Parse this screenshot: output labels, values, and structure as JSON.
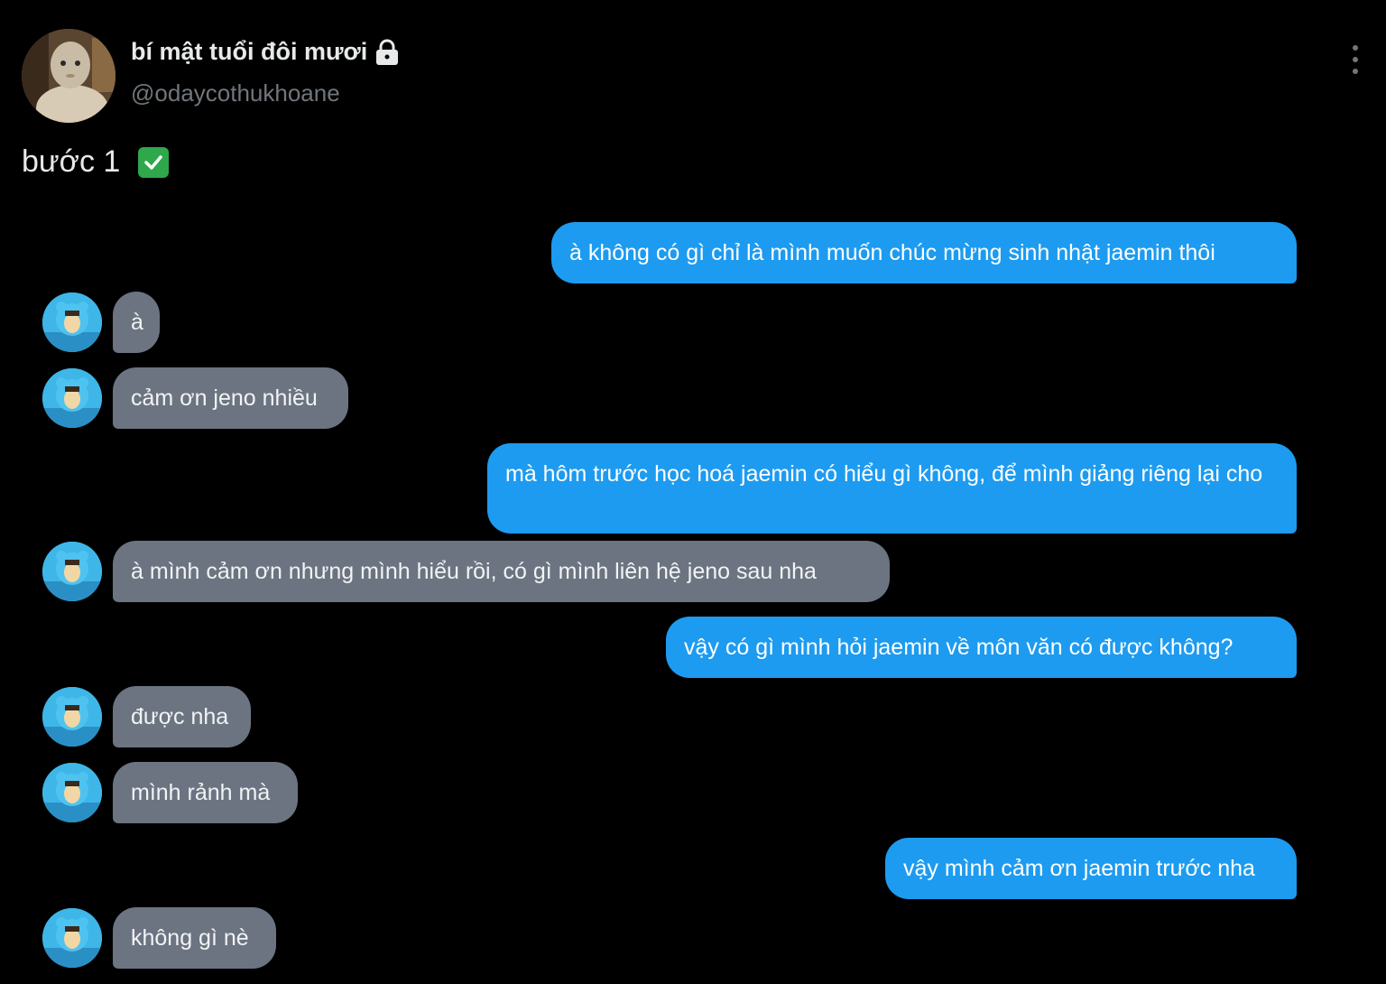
{
  "user": {
    "display_name": "bí mật tuổi đôi mươi",
    "handle": "@odaycothukhoane",
    "icons": {
      "protected": "lock-icon",
      "more": "more-dots-icon",
      "avatar": "doll-avatar"
    }
  },
  "post": {
    "text": "bước 1",
    "emoji_icon": "check-mark-icon"
  },
  "messages": [
    {
      "from": "me",
      "text": "à không có gì chỉ là mình muốn chúc mừng sinh nhật jaemin thôi"
    },
    {
      "from": "them",
      "text": "à"
    },
    {
      "from": "them",
      "text": "cảm ơn jeno nhiều"
    },
    {
      "from": "me",
      "text": "mà hôm trước học hoá jaemin có hiểu gì không, để mình giảng riêng lại cho"
    },
    {
      "from": "them",
      "text": "à mình cảm ơn nhưng mình hiểu rồi, có gì mình liên hệ jeno sau nha"
    },
    {
      "from": "me",
      "text": "vậy có gì mình hỏi jaemin về môn văn có được không?"
    },
    {
      "from": "them",
      "text": "được nha"
    },
    {
      "from": "them",
      "text": "mình rảnh mà"
    },
    {
      "from": "me",
      "text": "vậy mình cảm ơn jaemin trước nha"
    },
    {
      "from": "them",
      "text": "không gì nè"
    }
  ],
  "colors": {
    "background": "#000000",
    "sent_bubble": "#1d9bf0",
    "received_bubble": "#6b7480",
    "handle_gray": "#71767b"
  }
}
